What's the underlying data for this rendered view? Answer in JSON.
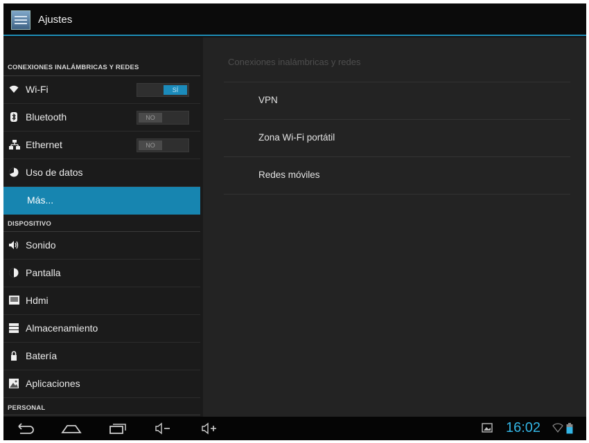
{
  "app": {
    "title": "Ajustes",
    "icon": "settings-app-icon"
  },
  "sidebar": {
    "sections": [
      {
        "label": "CONEXIONES INALÁMBRICAS Y REDES"
      },
      {
        "label": "DISPOSITIVO"
      },
      {
        "label": "PERSONAL"
      }
    ],
    "items": [
      {
        "label": "Wi-Fi",
        "icon": "wifi-icon",
        "toggle": "SÍ",
        "toggle_state": "on"
      },
      {
        "label": "Bluetooth",
        "icon": "bluetooth-icon",
        "toggle": "NO",
        "toggle_state": "off"
      },
      {
        "label": "Ethernet",
        "icon": "ethernet-icon",
        "toggle": "NO",
        "toggle_state": "off"
      },
      {
        "label": "Uso de datos",
        "icon": "data-usage-icon"
      },
      {
        "label": "Más...",
        "icon": "",
        "selected": true
      },
      {
        "label": "Sonido",
        "icon": "speaker-icon"
      },
      {
        "label": "Pantalla",
        "icon": "display-icon"
      },
      {
        "label": "Hdmi",
        "icon": "hdmi-icon"
      },
      {
        "label": "Almacenamiento",
        "icon": "storage-icon"
      },
      {
        "label": "Batería",
        "icon": "battery-icon"
      },
      {
        "label": "Aplicaciones",
        "icon": "apps-icon"
      }
    ]
  },
  "content": {
    "header": "Conexiones inalámbricas y redes",
    "rows": [
      {
        "label": "VPN"
      },
      {
        "label": "Zona Wi-Fi portátil"
      },
      {
        "label": "Redes móviles"
      }
    ]
  },
  "status": {
    "time": "16:02",
    "accent": "#33b5e5",
    "selection_color": "#1785b0"
  },
  "navbar": {
    "buttons": [
      "back-icon",
      "home-icon",
      "recent-apps-icon",
      "volume-down-icon",
      "volume-up-icon"
    ]
  }
}
